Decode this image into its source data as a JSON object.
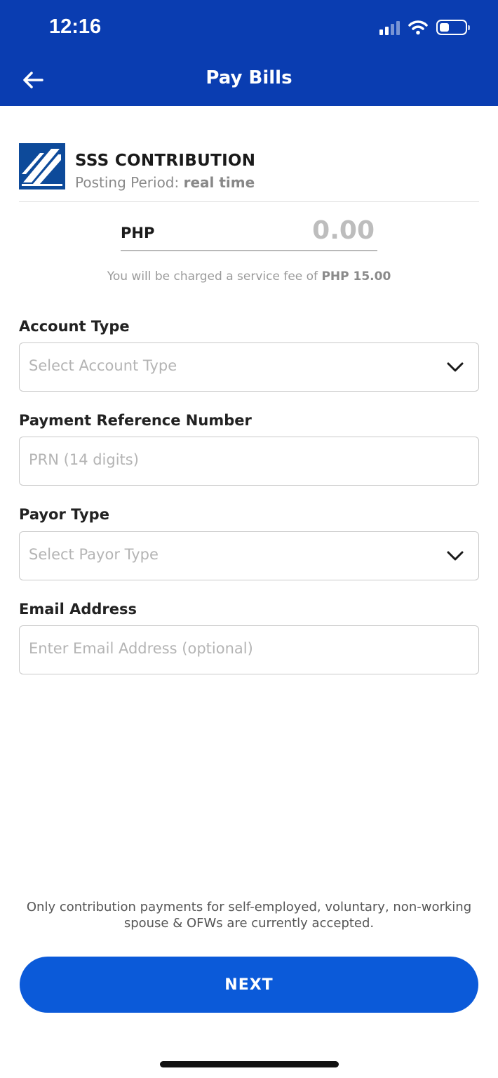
{
  "status_bar": {
    "time": "12:16"
  },
  "header": {
    "title": "Pay Bills",
    "background_color": "#0a3db1"
  },
  "biller": {
    "name": "SSS CONTRIBUTION",
    "posting_label": "Posting Period:",
    "posting_value": "real time"
  },
  "amount": {
    "currency": "PHP",
    "value": "0.00"
  },
  "fee_note": {
    "prefix": "You will be charged a service fee of",
    "fee": "PHP 15.00"
  },
  "fields": {
    "account_type": {
      "label": "Account Type",
      "placeholder": "Select Account Type"
    },
    "prn": {
      "label": "Payment Reference Number",
      "placeholder": "PRN (14 digits)"
    },
    "payor_type": {
      "label": "Payor Type",
      "placeholder": "Select Payor Type"
    },
    "email": {
      "label": "Email Address",
      "placeholder": "Enter Email Address (optional)"
    }
  },
  "disclaimer": "Only contribution payments for self-employed, voluntary, non-working spouse & OFWs are currently accepted.",
  "actions": {
    "next_label": "NEXT",
    "next_color": "#0b5ad9"
  },
  "icons": {
    "back": "arrow-left-icon",
    "dropdown": "chevron-down-icon",
    "signal": "cellular-signal-icon",
    "wifi": "wifi-icon",
    "battery": "battery-icon"
  }
}
